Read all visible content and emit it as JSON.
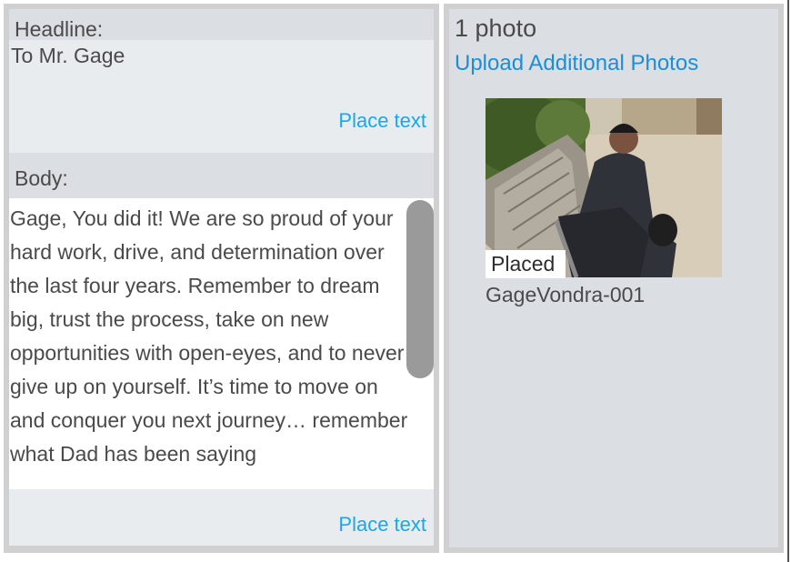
{
  "headline": {
    "label": "Headline:",
    "value": "To Mr. Gage",
    "place_text": "Place text"
  },
  "body": {
    "label": "Body:",
    "value": "Gage, You did it! We are so proud of your hard work, drive, and determination over the last four years. Remember to dream big, trust the process, take on new opportunities with open-eyes, and to never give up on yourself. It’s time to move on and conquer you next journey… remember what Dad has been saying",
    "place_text": "Place text"
  },
  "photos": {
    "count_label": "1 photo",
    "upload_label": "Upload Additional Photos",
    "items": [
      {
        "status": "Placed",
        "name": "GageVondra-001"
      }
    ]
  },
  "colors": {
    "link": "#19a8e6",
    "upload_link": "#1b8fd6",
    "panel_bg": "#dbdee2",
    "scrollbar": "#9a9a9a"
  }
}
